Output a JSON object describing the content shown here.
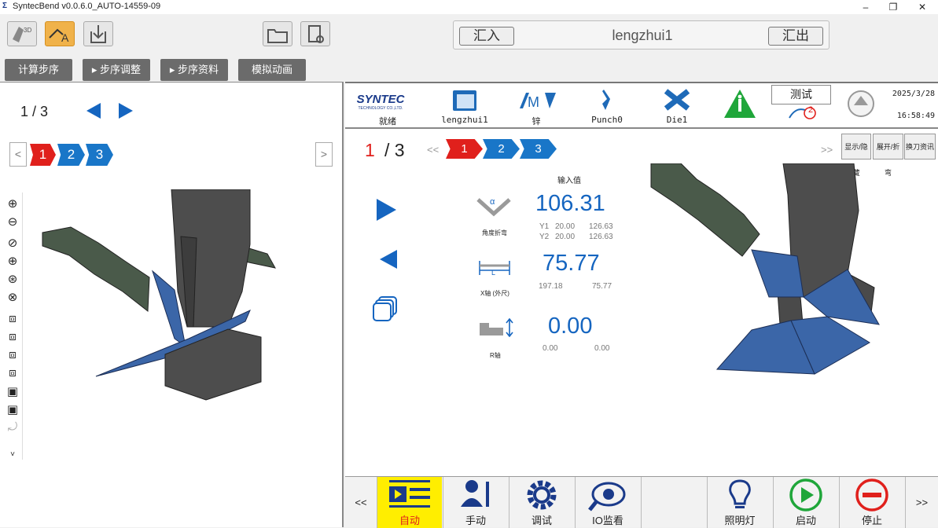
{
  "window": {
    "title": "SyntecBend v0.0.6.0_AUTO-14559-09",
    "minimize": "–",
    "restore": "❐",
    "close": "✕"
  },
  "toolbar": {
    "import_label": "汇入",
    "export_label": "汇出",
    "filename": "lengzhui1",
    "steps": [
      "计算步序",
      "▸ 步序调整",
      "▸ 步序资料",
      "模拟动画"
    ]
  },
  "left": {
    "page": "1 / 3",
    "steps": [
      "1",
      "2",
      "3"
    ],
    "prev_label": "<",
    "next_label": ">"
  },
  "status": {
    "brand": "SYNTEC",
    "brand_sub": "TECHNOLOGY CO.,LTD.",
    "state": "就绪",
    "program": "lengzhui1",
    "material": "锌",
    "punch": "Punch0",
    "die": "Die1",
    "test_label": "测试",
    "alarm_count": "2",
    "date": "2025/3/28",
    "time": "16:58:49"
  },
  "main": {
    "current": "1",
    "total": "/ 3",
    "prev_nav": "<<",
    "next_nav": ">>",
    "steps": [
      "1",
      "2",
      "3"
    ],
    "buttons": [
      "显示/隐藏",
      "展开/折弯",
      "换刀资讯"
    ],
    "input_header": "输入值",
    "angle": {
      "label": "角度折弯",
      "value": "106.31",
      "y1_label": "Y1",
      "y1_a": "20.00",
      "y1_b": "126.63",
      "y2_label": "Y2",
      "y2_a": "20.00",
      "y2_b": "126.63"
    },
    "x": {
      "label": "X轴 (外尺)",
      "value": "75.77",
      "a": "197.18",
      "b": "75.77"
    },
    "r": {
      "label": "R轴",
      "value": "0.00",
      "a": "0.00",
      "b": "0.00"
    }
  },
  "bottom": {
    "prev": "<<",
    "next": ">>",
    "buttons": [
      "自动",
      "手动",
      "调试",
      "IO监看",
      "",
      "照明灯",
      "启动",
      "停止"
    ]
  },
  "colors": {
    "accent_blue": "#1565c0",
    "step_red": "#e0201c",
    "step_blue": "#1976c8",
    "auto_yellow": "#ffee00",
    "model_green": "#4a5a4a",
    "model_gray": "#4a4a4a",
    "sheet_blue": "#3b66a8"
  }
}
